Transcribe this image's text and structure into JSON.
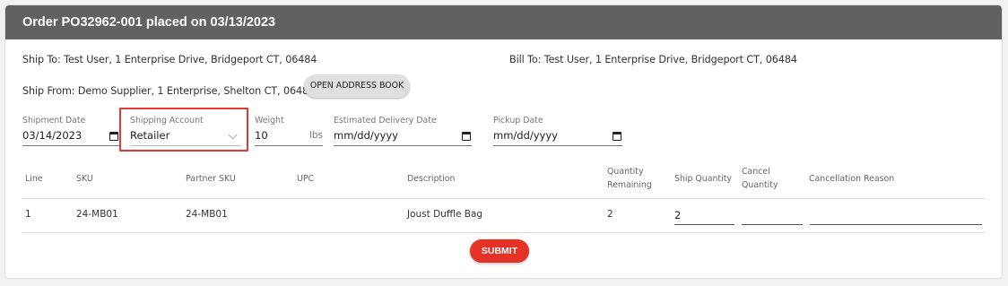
{
  "header": {
    "title": "Order PO32962-001 placed on 03/13/2023"
  },
  "addresses": {
    "ship_to": "Ship To: Test User, 1 Enterprise Drive, Bridgeport CT, 06484",
    "bill_to": "Bill To: Test User, 1 Enterprise Drive, Bridgeport CT, 06484",
    "ship_from": "Ship From: Demo Supplier, 1 Enterprise, Shelton CT, 06484",
    "open_address_book_label": "OPEN ADDRESS BOOK"
  },
  "shipment_form": {
    "shipment_date": {
      "label": "Shipment Date",
      "value": "03/14/2023"
    },
    "shipping_account": {
      "label": "Shipping Account",
      "value": "Retailer"
    },
    "weight": {
      "label": "Weight",
      "value": "10",
      "unit": "lbs"
    },
    "estimated_delivery": {
      "label": "Estimated Delivery Date",
      "value": "mm/dd/yyyy"
    },
    "pickup_date": {
      "label": "Pickup Date",
      "value": "mm/dd/yyyy"
    }
  },
  "line_table": {
    "headers": {
      "line": "Line",
      "sku": "SKU",
      "partner_sku": "Partner SKU",
      "upc": "UPC",
      "description": "Description",
      "quantity_remaining_1": "Quantity",
      "quantity_remaining_2": "Remaining",
      "ship_quantity": "Ship Quantity",
      "cancel_quantity_1": "Cancel",
      "cancel_quantity_2": "Quantity",
      "cancellation_reason": "Cancellation Reason"
    },
    "rows": [
      {
        "line": "1",
        "sku": "24-MB01",
        "partner_sku": "24-MB01",
        "upc": "",
        "description": "Joust Duffle Bag",
        "quantity_remaining": "2",
        "ship_quantity": "2",
        "cancel_quantity": "",
        "cancellation_reason": ""
      }
    ]
  },
  "submit_label": "SUBMIT",
  "colors": {
    "header_bg": "#616161",
    "submit_bg": "#e53226",
    "highlight": "#e53935"
  }
}
